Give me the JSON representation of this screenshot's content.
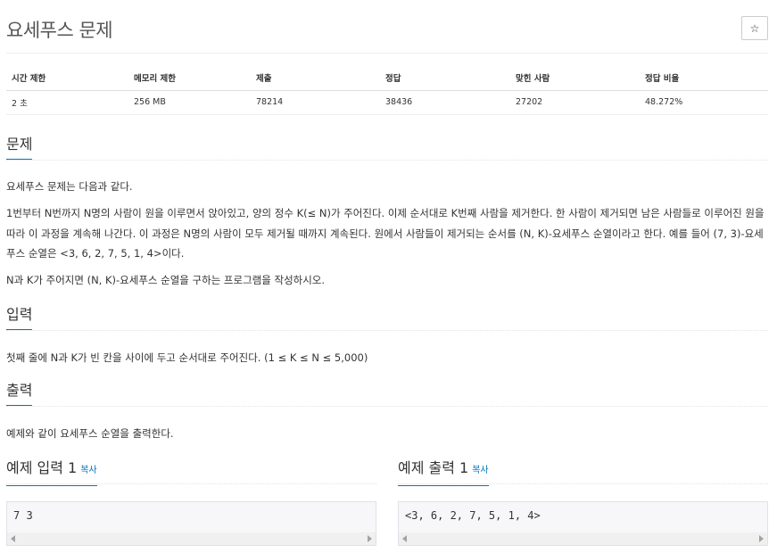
{
  "problem": {
    "title": "요세푸스 문제",
    "star_icon": "☆"
  },
  "info_table": {
    "headers": [
      "시간 제한",
      "메모리 제한",
      "제출",
      "정답",
      "맞힌 사람",
      "정답 비율"
    ],
    "values": [
      "2 초",
      "256 MB",
      "78214",
      "38436",
      "27202",
      "48.272%"
    ]
  },
  "sections": {
    "description": {
      "heading": "문제",
      "paragraphs": [
        "요세푸스 문제는 다음과 같다.",
        "1번부터 N번까지 N명의 사람이 원을 이루면서 앉아있고, 양의 정수 K(≤ N)가 주어진다. 이제 순서대로 K번째 사람을 제거한다. 한 사람이 제거되면 남은 사람들로 이루어진 원을 따라 이 과정을 계속해 나간다. 이 과정은 N명의 사람이 모두 제거될 때까지 계속된다. 원에서 사람들이 제거되는 순서를 (N, K)-요세푸스 순열이라고 한다. 예를 들어 (7, 3)-요세푸스 순열은 <3, 6, 2, 7, 5, 1, 4>이다.",
        "N과 K가 주어지면 (N, K)-요세푸스 순열을 구하는 프로그램을 작성하시오."
      ]
    },
    "input": {
      "heading": "입력",
      "text": "첫째 줄에 N과 K가 빈 칸을 사이에 두고 순서대로 주어진다. (1 ≤ K ≤ N ≤ 5,000)"
    },
    "output": {
      "heading": "출력",
      "text": "예제와 같이 요세푸스 순열을 출력한다."
    }
  },
  "samples": {
    "input": {
      "title": "예제 입력 1",
      "copy_label": "복사",
      "content": "7 3"
    },
    "output": {
      "title": "예제 출력 1",
      "copy_label": "복사",
      "content": "<3, 6, 2, 7, 5, 1, 4>"
    }
  },
  "colors": {
    "accent": "#0076c0",
    "pre_background": "#f7f7f9"
  }
}
